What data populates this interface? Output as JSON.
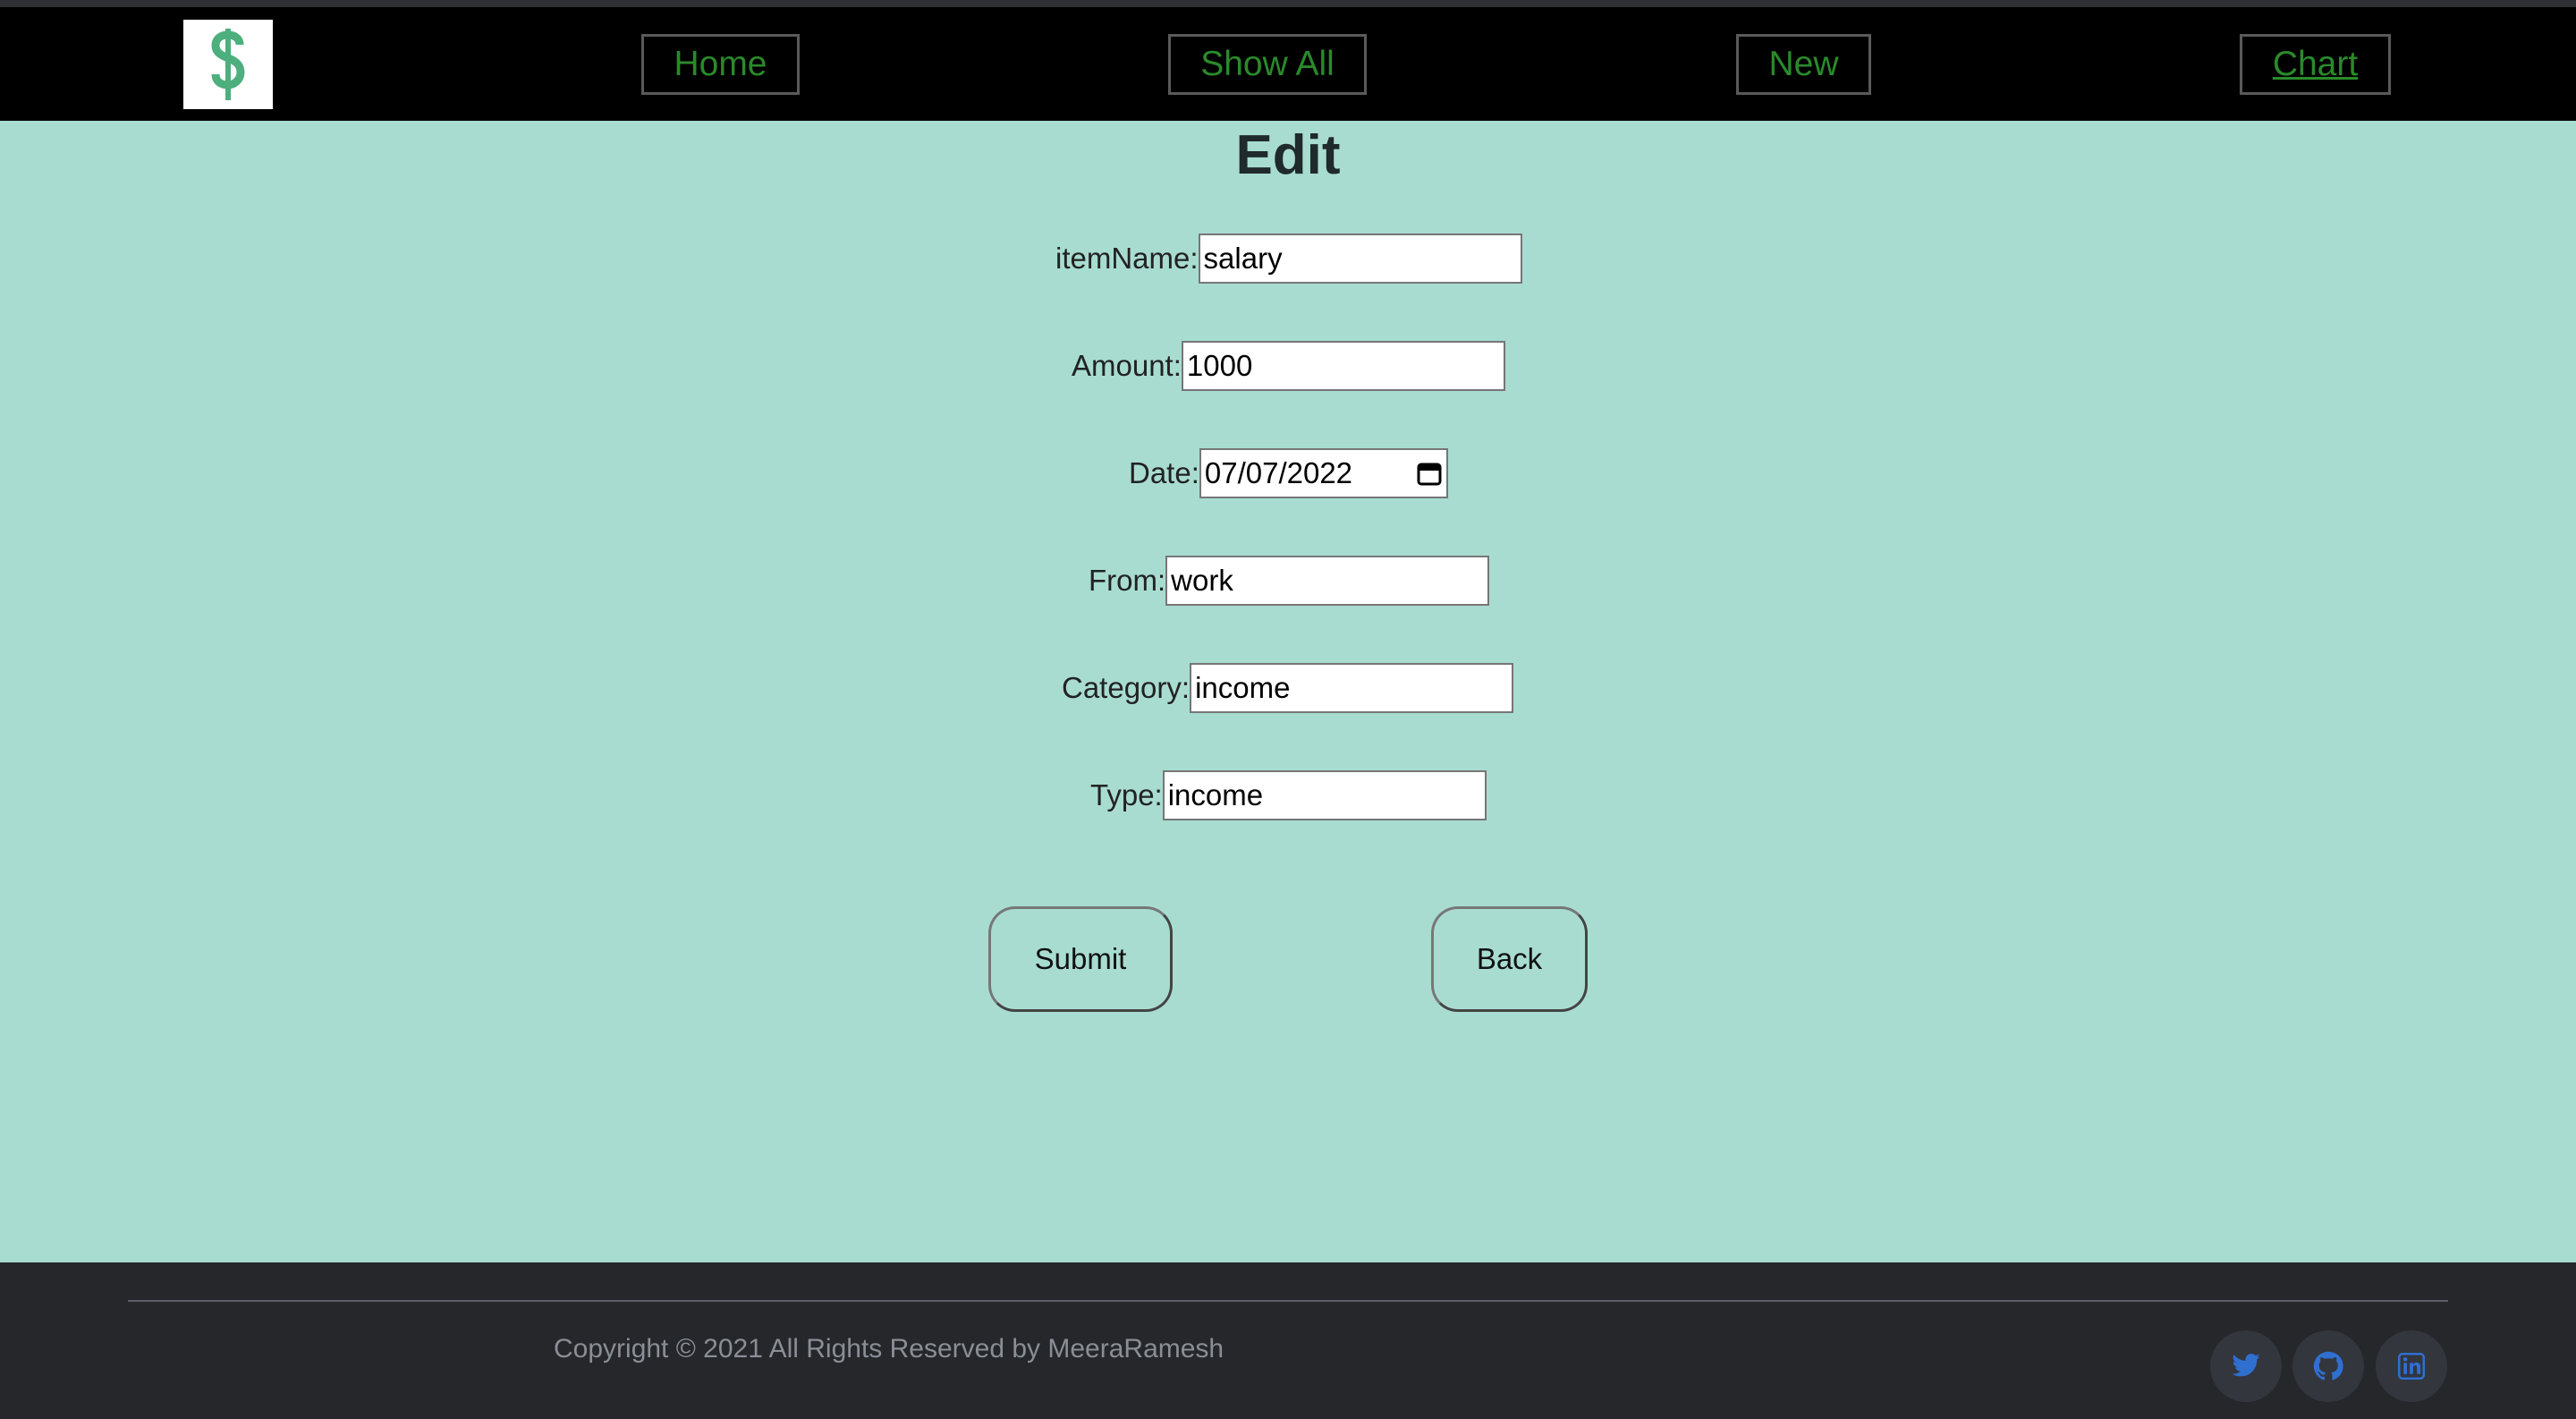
{
  "nav": {
    "logo_icon": "dollar-sign-icon",
    "home": "Home",
    "show_all": "Show All",
    "new": "New",
    "chart": "Chart"
  },
  "page": {
    "title": "Edit"
  },
  "form": {
    "item_name": {
      "label": "itemName:",
      "value": "salary"
    },
    "amount": {
      "label": "Amount:",
      "value": "1000"
    },
    "date": {
      "label": "Date:",
      "value": "07/07/2022"
    },
    "from": {
      "label": "From:",
      "value": "work"
    },
    "category": {
      "label": "Category:",
      "value": "income"
    },
    "type": {
      "label": "Type:",
      "value": "income"
    },
    "submit": "Submit",
    "back": "Back"
  },
  "footer": {
    "copyright": "Copyright © 2021 All Rights Reserved by MeeraRamesh",
    "social_icons": [
      "twitter-icon",
      "github-icon",
      "linkedin-icon"
    ]
  },
  "colors": {
    "page_bg": "#a8dcd1",
    "nav_bg": "#000000",
    "nav_link": "#2a8a2a",
    "footer_bg": "#25272b",
    "accent_logo": "#4caf7d",
    "social_icon": "#2f6fd0"
  }
}
